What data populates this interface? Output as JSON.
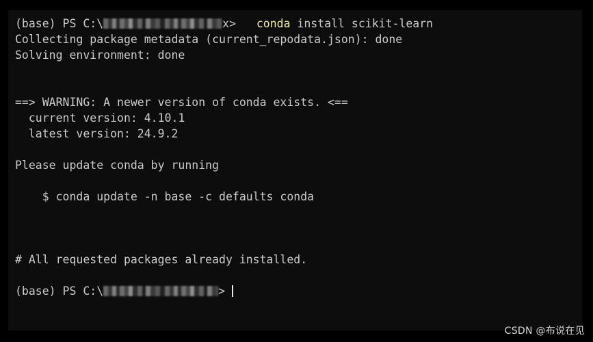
{
  "terminal": {
    "prompt_prefix": "(base) PS C:\\",
    "path_redacted_label": "redacted-user-path",
    "prompt_suffix_first": "x>",
    "prompt_suffix_last": ">",
    "command_spacing": "   ",
    "lines": [
      {
        "id": "prompt-command",
        "type": "prompt",
        "prefix": "(base) PS C:\\",
        "redacted": true,
        "suffix": "x>",
        "gap": "   ",
        "tokens": [
          {
            "text": "conda",
            "color": "yellow"
          },
          {
            "text": " install scikit-learn",
            "color": "default"
          }
        ]
      },
      {
        "id": "collecting-metadata",
        "type": "text",
        "text": "Collecting package metadata (current_repodata.json): done"
      },
      {
        "id": "solving-environment",
        "type": "text",
        "text": "Solving environment: done"
      },
      {
        "id": "blank-1",
        "type": "blank",
        "text": ""
      },
      {
        "id": "blank-2",
        "type": "blank",
        "text": ""
      },
      {
        "id": "warning-header",
        "type": "text",
        "text": "==> WARNING: A newer version of conda exists. <=="
      },
      {
        "id": "current-version",
        "type": "text",
        "text": "  current version: 4.10.1"
      },
      {
        "id": "latest-version",
        "type": "text",
        "text": "  latest version: 24.9.2"
      },
      {
        "id": "blank-3",
        "type": "blank",
        "text": ""
      },
      {
        "id": "please-update",
        "type": "text",
        "text": "Please update conda by running"
      },
      {
        "id": "blank-4",
        "type": "blank",
        "text": ""
      },
      {
        "id": "update-command",
        "type": "text",
        "text": "    $ conda update -n base -c defaults conda"
      },
      {
        "id": "blank-5",
        "type": "blank",
        "text": ""
      },
      {
        "id": "blank-6",
        "type": "blank",
        "text": ""
      },
      {
        "id": "blank-7",
        "type": "blank",
        "text": ""
      },
      {
        "id": "all-installed",
        "type": "text",
        "text": "# All requested packages already installed."
      },
      {
        "id": "blank-8",
        "type": "blank",
        "text": ""
      },
      {
        "id": "prompt-final",
        "type": "prompt",
        "prefix": "(base) PS C:\\",
        "redacted": true,
        "suffix": ">",
        "gap": " ",
        "cursor": true,
        "tokens": []
      }
    ],
    "versions": {
      "current": "4.10.1",
      "latest": "24.9.2"
    },
    "colors": {
      "background": "#0d0d0d",
      "surround": "#000000",
      "foreground": "#cccccc",
      "command_accent": "#f0e9a8",
      "cursor": "#e8e8e8"
    }
  },
  "watermark": {
    "text": "CSDN @布说在见"
  }
}
